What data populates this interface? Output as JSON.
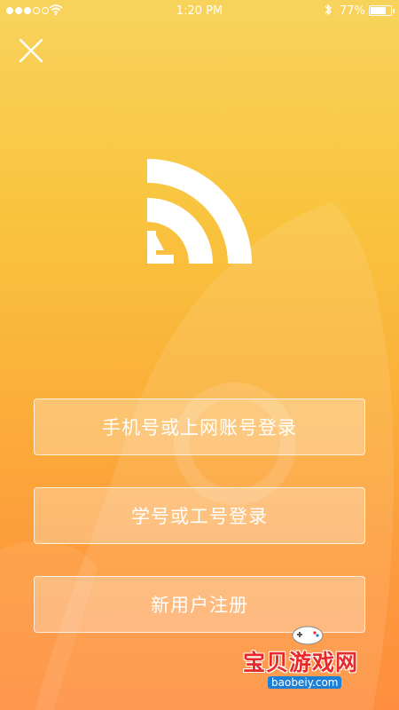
{
  "status_bar": {
    "time": "1:20 PM",
    "battery_percent": "77%",
    "battery_level": 0.77,
    "signal_bars_on": 3,
    "signal_bars_total": 5
  },
  "header": {
    "close_icon": "close-icon"
  },
  "logo": {
    "icon": "signal-wave-logo"
  },
  "actions": {
    "phone_login": "手机号或上网账号登录",
    "student_login": "学号或工号登录",
    "register": "新用户注册"
  },
  "watermark": {
    "title": "宝贝游戏网",
    "url": "baobeiy.com"
  },
  "colors": {
    "bg_top": "#f8d35c",
    "bg_bottom": "#fe8e3e",
    "watermark_red": "#e8282b",
    "watermark_blue": "#1e7fd6"
  }
}
